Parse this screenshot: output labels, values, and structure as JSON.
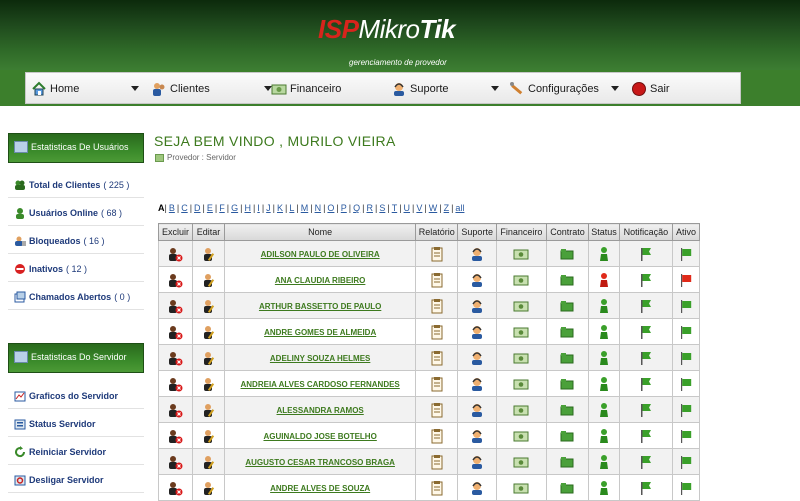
{
  "brand": {
    "isp": "ISP",
    "mikro": "Mikro",
    "tik": "Tik",
    "tagline": "gerenciamento de provedor"
  },
  "colors": {
    "header_dark": "#0c2a0c",
    "nav_green": "#3c7f2c",
    "accent_green": "#3d7a1e",
    "isp_red": "#d8241c",
    "link_blue": "#1e3a7a"
  },
  "nav": [
    {
      "label": "Home",
      "icon": "home-icon"
    },
    {
      "label": "Clientes",
      "icon": "users-icon"
    },
    {
      "label": "Financeiro",
      "icon": "money-icon"
    },
    {
      "label": "Suporte",
      "icon": "support-icon"
    },
    {
      "label": "Configurações",
      "icon": "tools-icon"
    },
    {
      "label": "Sair",
      "icon": "exit-icon"
    }
  ],
  "sidebar": {
    "users_title": "Estatisticas De Usuários",
    "users_items": [
      {
        "label": "Total de Clientes",
        "count": "( 225 )",
        "icon": "group-icon"
      },
      {
        "label": "Usuários Online",
        "count": "( 68 )",
        "icon": "user-online-icon"
      },
      {
        "label": "Bloqueados",
        "count": "( 16 )",
        "icon": "user-blocked-icon"
      },
      {
        "label": "Inativos",
        "count": "( 12 )",
        "icon": "no-entry-icon"
      },
      {
        "label": "Chamados Abertos",
        "count": "( 0 )",
        "icon": "tickets-icon"
      }
    ],
    "server_title": "Estatisticas Do Servidor",
    "server_items": [
      {
        "label": "Graficos do Servidor",
        "icon": "chart-icon"
      },
      {
        "label": "Status Servidor",
        "icon": "server-icon"
      },
      {
        "label": "Reiniciar Servidor",
        "icon": "restart-icon"
      },
      {
        "label": "Desligar Servidor",
        "icon": "shutdown-icon"
      }
    ]
  },
  "main": {
    "welcome": "SEJA BEM VINDO , MURILO VIEIRA",
    "breadcrumb": "Provedor : Servidor",
    "alphabet": [
      "A",
      "B",
      "C",
      "D",
      "E",
      "F",
      "G",
      "H",
      "I",
      "J",
      "K",
      "L",
      "M",
      "N",
      "O",
      "P",
      "Q",
      "R",
      "S",
      "T",
      "U",
      "V",
      "W",
      "Z",
      "all"
    ],
    "selected_letter": "A"
  },
  "table": {
    "headers": [
      "Excluir",
      "Editar",
      "Nome",
      "Relatório",
      "Suporte",
      "Financeiro",
      "Contrato",
      "Status",
      "Notificação",
      "Ativo"
    ],
    "rows": [
      {
        "name": "ADILSON PAULO DE OLIVEIRA",
        "status": "online",
        "active": "green"
      },
      {
        "name": "ANA CLAUDIA RIBEIRO",
        "status": "blocked",
        "active": "red"
      },
      {
        "name": "ARTHUR BASSETTO DE PAULO",
        "status": "online",
        "active": "green"
      },
      {
        "name": "ANDRE GOMES DE ALMEIDA",
        "status": "online",
        "active": "green"
      },
      {
        "name": "ADELINY SOUZA HELMES",
        "status": "online",
        "active": "green"
      },
      {
        "name": "ANDREIA ALVES CARDOSO FERNANDES",
        "status": "online",
        "active": "green"
      },
      {
        "name": "ALESSANDRA RAMOS",
        "status": "online",
        "active": "green"
      },
      {
        "name": "AGUINALDO JOSE BOTELHO",
        "status": "online",
        "active": "green"
      },
      {
        "name": "AUGUSTO CESAR TRANCOSO BRAGA",
        "status": "online",
        "active": "green"
      },
      {
        "name": "ANDRE ALVES DE SOUZA",
        "status": "online",
        "active": "green"
      }
    ]
  }
}
